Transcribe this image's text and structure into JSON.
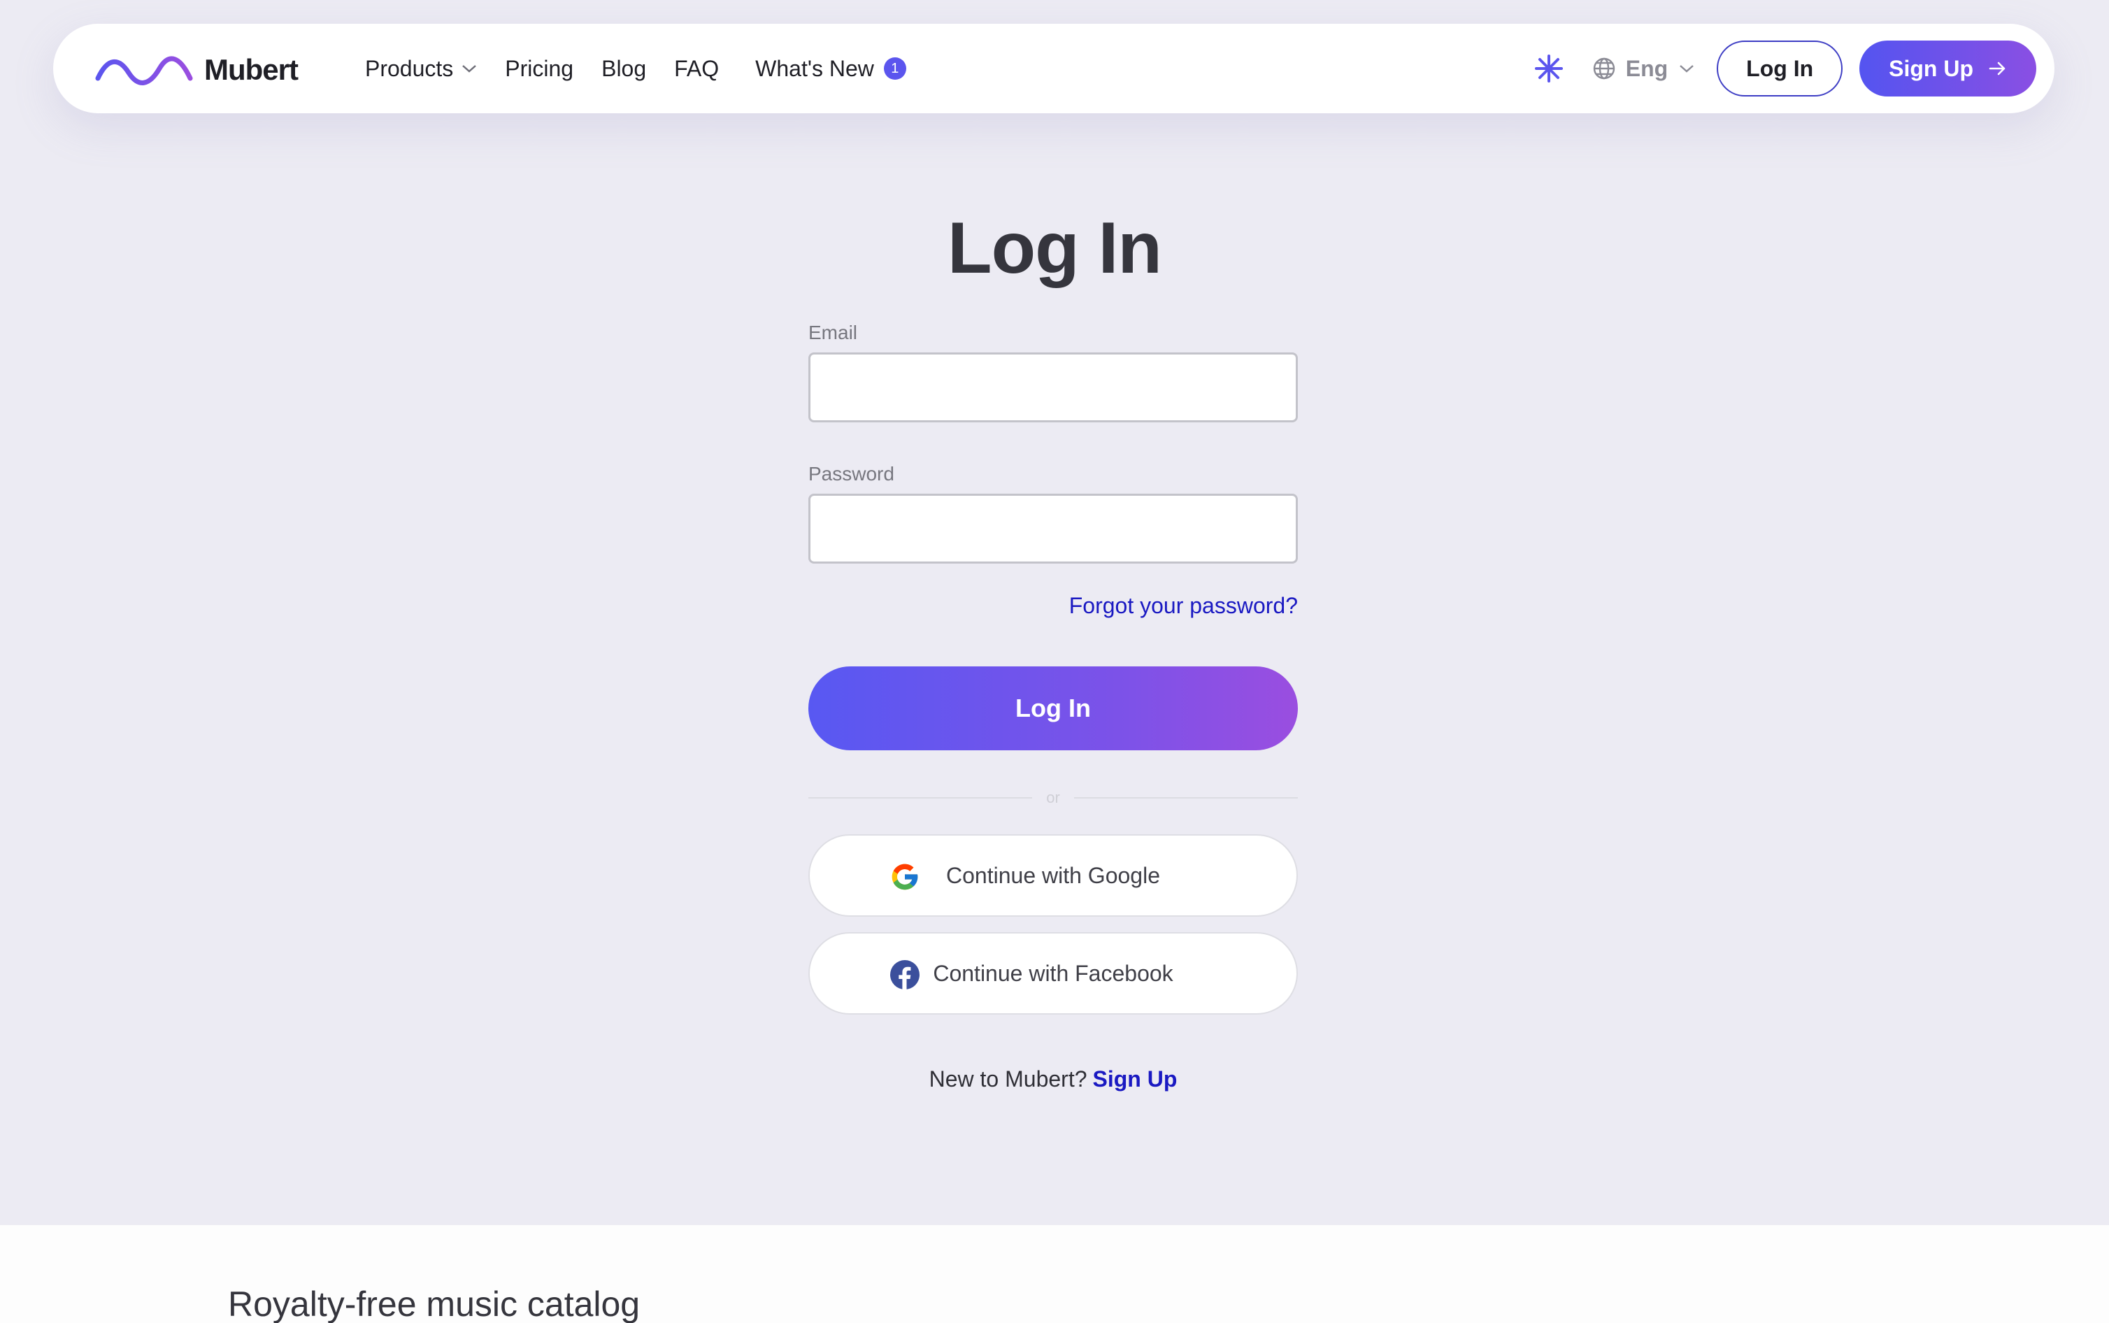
{
  "nav": {
    "brand": "Mubert",
    "links": [
      {
        "label": "Products",
        "has_dropdown": true
      },
      {
        "label": "Pricing"
      },
      {
        "label": "Blog"
      },
      {
        "label": "FAQ"
      },
      {
        "label": "What's New",
        "badge": "1"
      }
    ],
    "language": "Eng",
    "login_label": "Log In",
    "signup_label": "Sign Up"
  },
  "form": {
    "title": "Log In",
    "email_label": "Email",
    "email_value": "",
    "password_label": "Password",
    "password_value": "",
    "forgot_label": "Forgot your password?",
    "submit_label": "Log In",
    "divider_label": "or",
    "google_label": "Continue with Google",
    "facebook_label": "Continue with Facebook",
    "new_user_text": "New to Mubert?",
    "signup_link": "Sign Up"
  },
  "footer": {
    "section_title": "Royalty-free music catalog"
  },
  "colors": {
    "accent": "#5b55ee",
    "accent_end": "#9a4ee0",
    "link": "#1a19c2",
    "background": "#ecebf3"
  },
  "icons": [
    "mubert-wave-logo",
    "chevron-down-icon",
    "sparkle-icon",
    "globe-icon",
    "arrow-right-icon",
    "google-icon",
    "facebook-icon"
  ]
}
